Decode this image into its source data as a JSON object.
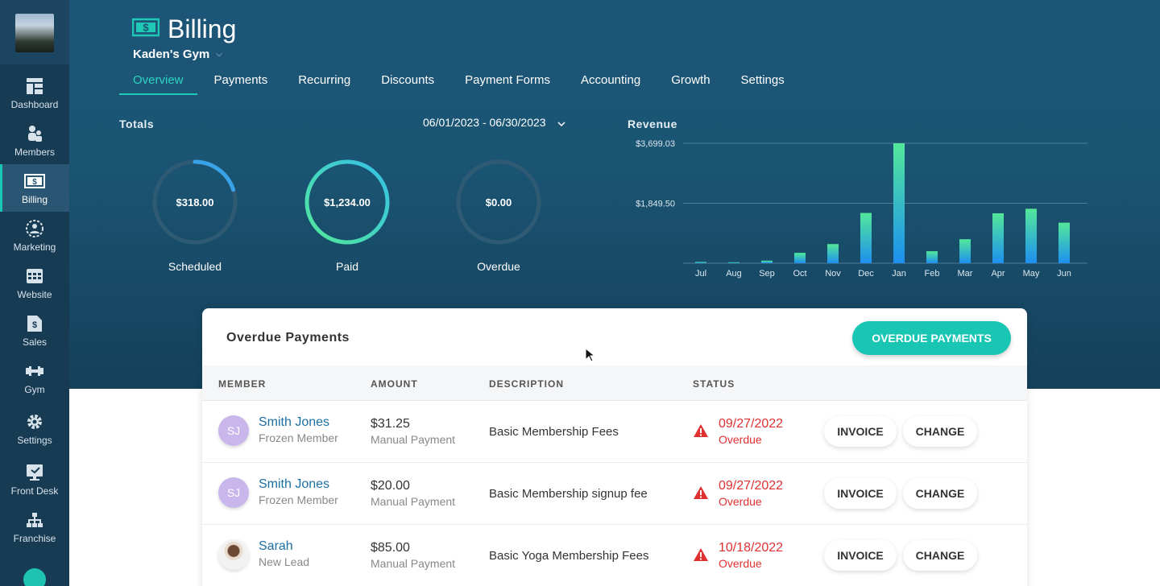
{
  "sidebar": {
    "items": [
      {
        "label": "Dashboard",
        "icon": "dashboard-icon"
      },
      {
        "label": "Members",
        "icon": "members-icon"
      },
      {
        "label": "Billing",
        "icon": "billing-icon",
        "active": true
      },
      {
        "label": "Marketing",
        "icon": "marketing-icon"
      },
      {
        "label": "Website",
        "icon": "website-icon"
      },
      {
        "label": "Sales",
        "icon": "sales-icon"
      },
      {
        "label": "Gym",
        "icon": "dumbbell-icon"
      },
      {
        "label": "Settings",
        "icon": "gear-icon"
      },
      {
        "label": "Front Desk",
        "icon": "front-desk-icon"
      },
      {
        "label": "Franchise",
        "icon": "franchise-icon"
      }
    ]
  },
  "header": {
    "title": "Billing",
    "gym": "Kaden's Gym",
    "tabs": [
      {
        "label": "Overview",
        "active": true
      },
      {
        "label": "Payments"
      },
      {
        "label": "Recurring"
      },
      {
        "label": "Discounts"
      },
      {
        "label": "Payment Forms"
      },
      {
        "label": "Accounting"
      },
      {
        "label": "Growth"
      },
      {
        "label": "Settings"
      }
    ]
  },
  "totals": {
    "label": "Totals",
    "date_range": "06/01/2023 - 06/30/2023",
    "donuts": [
      {
        "value": "$318.00",
        "label": "Scheduled",
        "fraction": 0.2
      },
      {
        "value": "$1,234.00",
        "label": "Paid",
        "fraction": 1.0
      },
      {
        "value": "$0.00",
        "label": "Overdue",
        "fraction": 0
      }
    ]
  },
  "revenue": {
    "label": "Revenue"
  },
  "chart_data": {
    "type": "bar",
    "title": "Revenue",
    "categories": [
      "Jul",
      "Aug",
      "Sep",
      "Oct",
      "Nov",
      "Dec",
      "Jan",
      "Feb",
      "Mar",
      "Apr",
      "May",
      "Jun"
    ],
    "values": [
      40,
      30,
      80,
      320,
      590,
      1550,
      3699.03,
      370,
      740,
      1540,
      1680,
      1250
    ],
    "y_ticks": [
      "$3,699.03",
      "$1,849.50"
    ],
    "ylim": [
      0,
      3699.03
    ],
    "grid": true
  },
  "overdue": {
    "title": "Overdue Payments",
    "button": "OVERDUE PAYMENTS",
    "columns": [
      "MEMBER",
      "AMOUNT",
      "DESCRIPTION",
      "STATUS"
    ],
    "invoice_label": "INVOICE",
    "change_label": "CHANGE",
    "rows": [
      {
        "initials": "SJ",
        "name": "Smith Jones",
        "type": "Frozen Member",
        "amount": "$31.25",
        "method": "Manual Payment",
        "description": "Basic Membership Fees",
        "date": "09/27/2022",
        "status": "Overdue"
      },
      {
        "initials": "SJ",
        "name": "Smith Jones",
        "type": "Frozen Member",
        "amount": "$20.00",
        "method": "Manual Payment",
        "description": "Basic Membership signup fee",
        "date": "09/27/2022",
        "status": "Overdue"
      },
      {
        "initials": "",
        "name": "Sarah",
        "type": "New Lead",
        "amount": "$85.00",
        "method": "Manual Payment",
        "description": "Basic Yoga Membership Fees",
        "date": "10/18/2022",
        "status": "Overdue"
      }
    ]
  },
  "colors": {
    "accent": "#19c5b3",
    "danger": "#e03131",
    "sidebar": "#173b53",
    "header": "#1b5574"
  }
}
